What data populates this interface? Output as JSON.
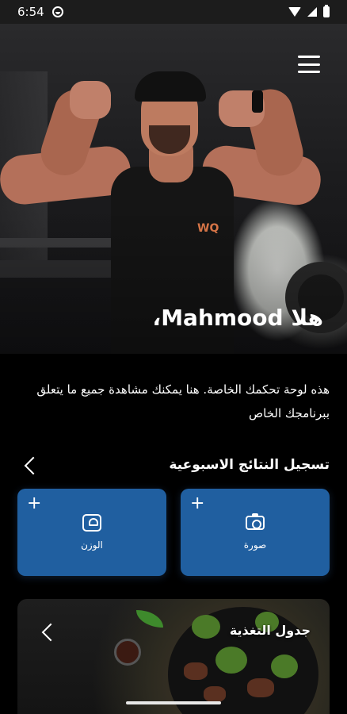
{
  "status_bar": {
    "time": "6:54",
    "icons": [
      "app-notification-icon",
      "wifi-icon",
      "signal-icon",
      "battery-icon"
    ]
  },
  "hero": {
    "greeting": "هلا Mahmood،",
    "menu_icon": "hamburger-menu-icon"
  },
  "intro_text": "هذه  لوحة تحكمك الخاصة. هنا يمكنك مشاهدة جميع ما يتعلق ببرنامجك الخاص",
  "weekly_results": {
    "title": "تسجيل النتائج الاسبوعية",
    "cards": [
      {
        "label": "صورة",
        "icon": "camera-icon",
        "action": "+"
      },
      {
        "label": "الوزن",
        "icon": "scale-icon",
        "action": "+"
      }
    ]
  },
  "nutrition": {
    "title": "جدول التغذية"
  },
  "colors": {
    "background": "#000000",
    "card_blue": "#205fa0",
    "text": "#ffffff"
  }
}
